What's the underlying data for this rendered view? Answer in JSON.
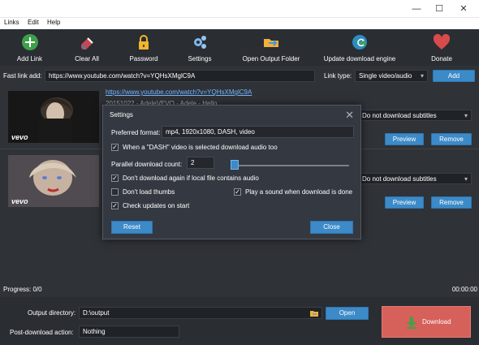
{
  "window": {
    "minimize": "—",
    "maximize": "☐",
    "close": "✕"
  },
  "menu": [
    "Links",
    "Edit",
    "Help"
  ],
  "toolbar": {
    "add_link": "Add Link",
    "clear_all": "Clear All",
    "password": "Password",
    "settings": "Settings",
    "open_output_folder": "Open Output Folder",
    "update_download_engine": "Update download engine",
    "donate": "Donate"
  },
  "fast_link": {
    "label": "Fast link add:",
    "value": "https://www.youtube.com/watch?v=YQHsXMglC9A"
  },
  "link_type": {
    "label": "Link type:",
    "value": "Single video/audio"
  },
  "add_button": "Add",
  "items": [
    {
      "url": "https://www.youtube.com/watch?v=YQHsXMglC9A",
      "meta": "20151022 - AdeleVEVO - Adele - Hello",
      "subtitle": "Do not download subtitles",
      "preview": "Preview",
      "remove": "Remove",
      "thumb_text": "vevo"
    },
    {
      "subtitle": "Do not download subtitles",
      "preview": "Preview",
      "remove": "Remove",
      "thumb_text": "vevo"
    }
  ],
  "progress": {
    "label": "Progress: 0/0",
    "time": "00:00:00"
  },
  "output": {
    "label": "Output directory:",
    "value": "D:\\output",
    "open": "Open"
  },
  "post_download": {
    "label": "Post-download action:",
    "value": "Nothing"
  },
  "download_button": "Download",
  "settings_modal": {
    "title": "Settings",
    "close": "✕",
    "preferred_format_label": "Preferred format:",
    "preferred_format_value": "mp4, 1920x1080, DASH, video",
    "dash_text": "When a \"DASH\" video is selected download audio too",
    "parallel_label": "Parallel download count:",
    "parallel_value": "2",
    "parallel_level": 0.2,
    "dont_download_again": "Don't download again if  local file contains audio",
    "dont_load_thumbs": "Don't load thumbs",
    "play_sound": "Play a sound when download is done",
    "check_updates": "Check updates on start",
    "reset": "Reset",
    "close_button": "Close"
  }
}
